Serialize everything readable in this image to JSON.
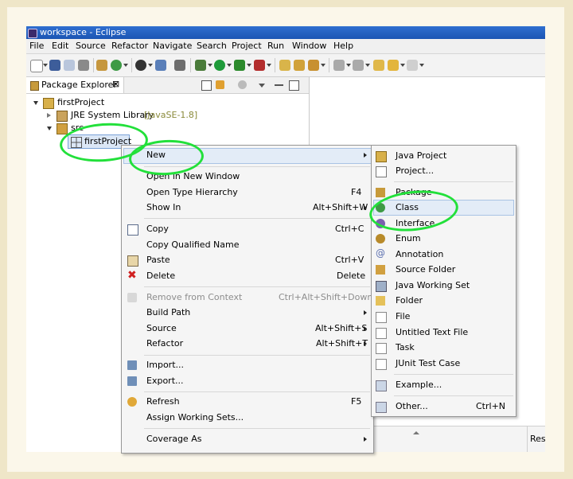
{
  "window": {
    "title": "workspace - Eclipse"
  },
  "menubar": [
    "File",
    "Edit",
    "Source",
    "Refactor",
    "Navigate",
    "Search",
    "Project",
    "Run",
    "Window",
    "Help"
  ],
  "package_explorer": {
    "tab_label": "Package Explorer",
    "close_glyph": "⊠",
    "tree": {
      "project": "firstProject",
      "jre": "JRE System Library",
      "jre_version": "[JavaSE-1.8]",
      "src": "src",
      "package": "firstProject"
    }
  },
  "context_menu": {
    "new_label": "New",
    "items": [
      {
        "label": "Open in New Window",
        "shortcut": ""
      },
      {
        "label": "Open Type Hierarchy",
        "shortcut": "F4"
      },
      {
        "label": "Show In",
        "shortcut": "Alt+Shift+W"
      },
      {
        "label": "Copy",
        "shortcut": "Ctrl+C"
      },
      {
        "label": "Copy Qualified Name",
        "shortcut": ""
      },
      {
        "label": "Paste",
        "shortcut": "Ctrl+V"
      },
      {
        "label": "Delete",
        "shortcut": "Delete"
      },
      {
        "label": "Remove from Context",
        "shortcut": "Ctrl+Alt+Shift+Down"
      },
      {
        "label": "Build Path",
        "shortcut": ""
      },
      {
        "label": "Source",
        "shortcut": "Alt+Shift+S"
      },
      {
        "label": "Refactor",
        "shortcut": "Alt+Shift+T"
      },
      {
        "label": "Import...",
        "shortcut": ""
      },
      {
        "label": "Export...",
        "shortcut": ""
      },
      {
        "label": "Refresh",
        "shortcut": "F5"
      },
      {
        "label": "Assign Working Sets...",
        "shortcut": ""
      },
      {
        "label": "Coverage As",
        "shortcut": ""
      }
    ]
  },
  "submenu": {
    "items": [
      {
        "label": "Java Project"
      },
      {
        "label": "Project..."
      },
      {
        "label": "Package"
      },
      {
        "label": "Class"
      },
      {
        "label": "Interface"
      },
      {
        "label": "Enum"
      },
      {
        "label": "Annotation"
      },
      {
        "label": "Source Folder"
      },
      {
        "label": "Java Working Set"
      },
      {
        "label": "Folder"
      },
      {
        "label": "File"
      },
      {
        "label": "Untitled Text File"
      },
      {
        "label": "Task"
      },
      {
        "label": "JUnit Test Case"
      },
      {
        "label": "Example..."
      },
      {
        "label": "Other...",
        "shortcut": "Ctrl+N"
      }
    ]
  },
  "bottom_panel": {
    "column_header": "Reso"
  },
  "colors": {
    "annotation_green": "#22e03a",
    "highlight": "#e3ecf7",
    "title_blue": "#1b55b3"
  }
}
